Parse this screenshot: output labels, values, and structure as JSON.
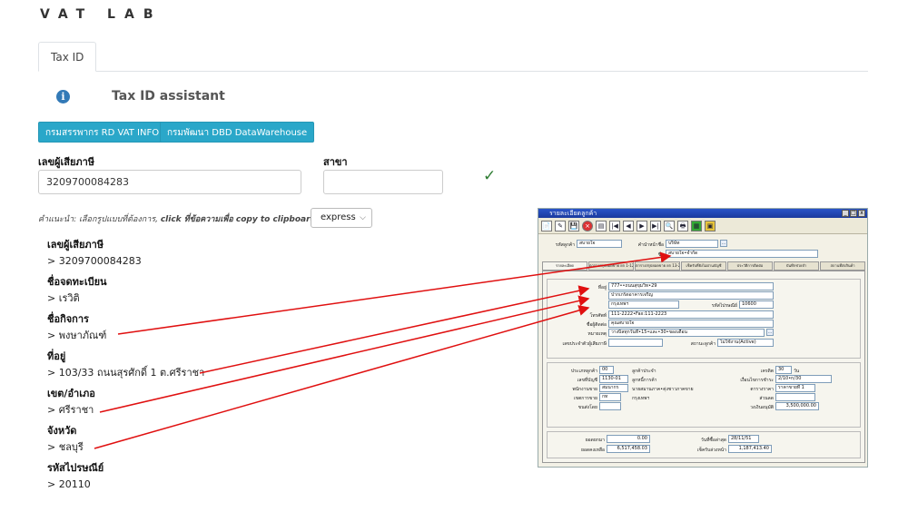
{
  "brand": "VAT LAB",
  "tabs": [
    {
      "label": "Tax ID"
    }
  ],
  "assistant": {
    "title": "Tax ID assistant",
    "info_icon": "i"
  },
  "buttons": {
    "rd": "กรมสรรพากร RD VAT INFO",
    "dbd": "กรมพัฒนา DBD DataWarehouse"
  },
  "form": {
    "taxid_label": "เลขผู้เสียภาษี",
    "taxid_value": "3209700084283",
    "branch_label": "สาขา",
    "branch_value": "",
    "valid_mark": "✓"
  },
  "hint": {
    "text": "คำแนะนำ: เลือกรูปแบบที่ต้องการ, ",
    "highlight": "click ที่ข้อความเพื่อ copy to clipboard"
  },
  "format_select": {
    "selected": "express",
    "chevron": "⌵"
  },
  "fields": [
    {
      "label": "เลขผู้เสียภาษี",
      "value": "> 3209700084283"
    },
    {
      "label": "ชื่อจดทะเบียน",
      "value": "> เรวิติ"
    },
    {
      "label": "ชื่อกิจการ",
      "value": "> พงษาภัณฑ์"
    },
    {
      "label": "ที่อยู่",
      "value": "> 103/33 ถนนสุรศักดิ์ 1 ต.ศรีราชา"
    },
    {
      "label": "เขต/อำเภอ",
      "value": "> ศรีราชา"
    },
    {
      "label": "จังหวัด",
      "value": "> ชลบุรี"
    },
    {
      "label": "รหัสไปรษณีย์",
      "value": "> 20110"
    }
  ],
  "legacy_app": {
    "title": "รายละเอียดลูกค้า",
    "window_buttons": [
      "_",
      "□",
      "x"
    ],
    "toolbar_icons": [
      "📄",
      "✎",
      "💾",
      "⨯",
      "▤",
      "|◀",
      "◀",
      "▶",
      "▶|",
      "🔍",
      "🖶",
      "▦",
      "▣"
    ],
    "code_label": "รหัสลูกค้า",
    "code_value": "สบายใจ",
    "prefix_label": "คำนำหน้าชื่อ",
    "prefix_value": "บริษัท",
    "name_label": "ชื่อ",
    "name_value": "สบายใจ•จำกัด",
    "tabs": [
      "รายละเอียด",
      "ตารางสรุปยอดขาย ยก 1-12",
      "ตารางสรุปยอดขาย ยก 13-24",
      "เช็ครับที่ยังไม่ผ่านบัญชี",
      "ประวัติการติดต่อ",
      "บันทึกช่วยจำ",
      "สถานที่ส่งสินค้า"
    ],
    "address_label": "ที่อยู่",
    "address_lines": [
      "777••ถนนสุขุมวิท•29",
      "ปากเกร็ดอาคารเจริญ",
      "กรุงเทพฯ"
    ],
    "zip_label": "รหัสไปรษณีย์",
    "zip_value": "10600",
    "phone_label": "โทรศัพท์",
    "phone_value": "111-2222•Fax:111-2223",
    "contact_label": "ชื่อผู้ติดต่อ",
    "contact_value": "คุณสบายใจ",
    "note_label": "หมายเหตุ",
    "note_value": "วางบิลทุกวันที่•15•และ•30•ของเดือน",
    "taxid_label": "เลขประจำตัวผู้เสียภาษี",
    "taxid_value": "",
    "status_label": "สถานะลูกค้า",
    "status_value": "ไม่ใช้งาน(Active)",
    "type_label": "ประเภทลูกค้า",
    "type_value": "00",
    "acct_label": "เลขที่บัญชี",
    "acct_value": "1130-01",
    "sales_label": "พนักงานขาย",
    "sales_value": "สมนากร",
    "area_label": "เขตการขาย",
    "area_value": "กท",
    "ship_label": "ขนส่งโดย",
    "ship_value": "",
    "regular_label": "ลูกค้าประจำ",
    "debtor_label": "ลูกหนี้การค้า",
    "nickname_value": "นายสมานภาค•คุ่งชาวภาคขาย",
    "city_value": "กรุงเทพฯ",
    "credit_label": "เครดิต",
    "credit_value": "30",
    "credit_unit": "วัน",
    "terms_label": "เงื่อนไขการชำระ",
    "terms_value": "2/10•n/30",
    "price_label": "ตารางราคา",
    "price_value": "ราคาขายที่ 1",
    "discount_label": "ส่วนลด",
    "discount_value": "",
    "limit_label": "วงเงินอนุมัติ",
    "limit_value": "3,500,000.00",
    "beginning_label": "ยอดยกมา",
    "beginning_value": "0.00",
    "balance_label": "ยอดคงเหลือ",
    "balance_value": "6,517,458.03",
    "lastbuy_label": "วันที่ซื้อล่าสุด",
    "lastbuy_value": "28/11/51",
    "cheque_label": "เช็ครับล่วงหน้า",
    "cheque_value": "1,187,413.40"
  },
  "colors": {
    "button": "#2aa7c9",
    "arrow": "#e01010",
    "check": "#2e7d32",
    "info": "#337ab7"
  }
}
